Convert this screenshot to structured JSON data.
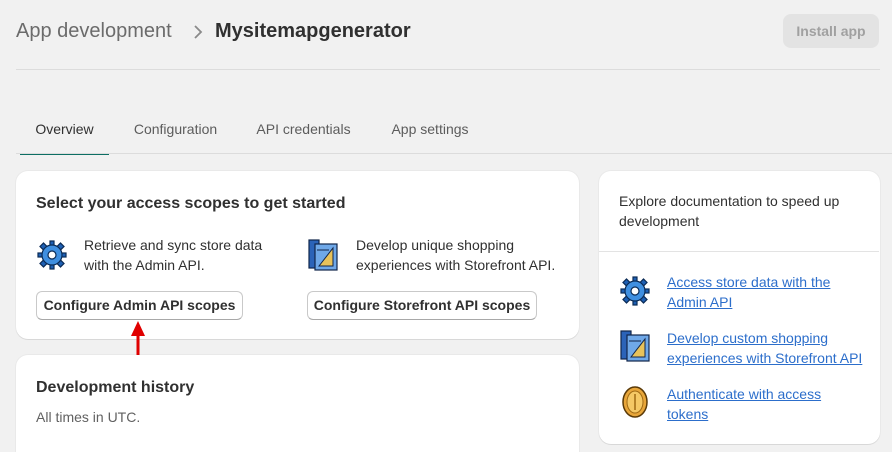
{
  "header": {
    "breadcrumb_parent": "App development",
    "separator": ">",
    "title": "Mysitemapgenerator",
    "install_label": "Install app"
  },
  "tabs": [
    {
      "label": "Overview",
      "active": true
    },
    {
      "label": "Configuration",
      "active": false
    },
    {
      "label": "API credentials",
      "active": false
    },
    {
      "label": "App settings",
      "active": false
    }
  ],
  "scopes_card": {
    "title": "Select your access scopes to get started",
    "admin": {
      "icon": "gear-icon",
      "description": "Retrieve and sync store data with the Admin API.",
      "line1": "Retrieve and sync store data",
      "line2": "with the Admin API.",
      "button_label": "Configure Admin API scopes"
    },
    "storefront": {
      "icon": "blueprint-icon",
      "line1": "Develop unique shopping",
      "line2": "experiences with Storefront API.",
      "button_label": "Configure Storefront API scopes"
    }
  },
  "history_card": {
    "title": "Development history",
    "subtitle": "All times in UTC."
  },
  "docs_card": {
    "heading_line1": "Explore documentation to speed up",
    "heading_line2": "development",
    "links": [
      {
        "icon": "gear-icon",
        "line1": "Access store data with the",
        "line2": "Admin API"
      },
      {
        "icon": "blueprint-icon",
        "line1": "Develop custom shopping",
        "line2": "experiences with Storefront API"
      },
      {
        "icon": "coin-icon",
        "line1": "Authenticate with access",
        "line2": "tokens"
      }
    ]
  },
  "colors": {
    "accent": "#0d6e63",
    "link": "#2c6ecb",
    "annotation_arrow": "#e00000"
  }
}
